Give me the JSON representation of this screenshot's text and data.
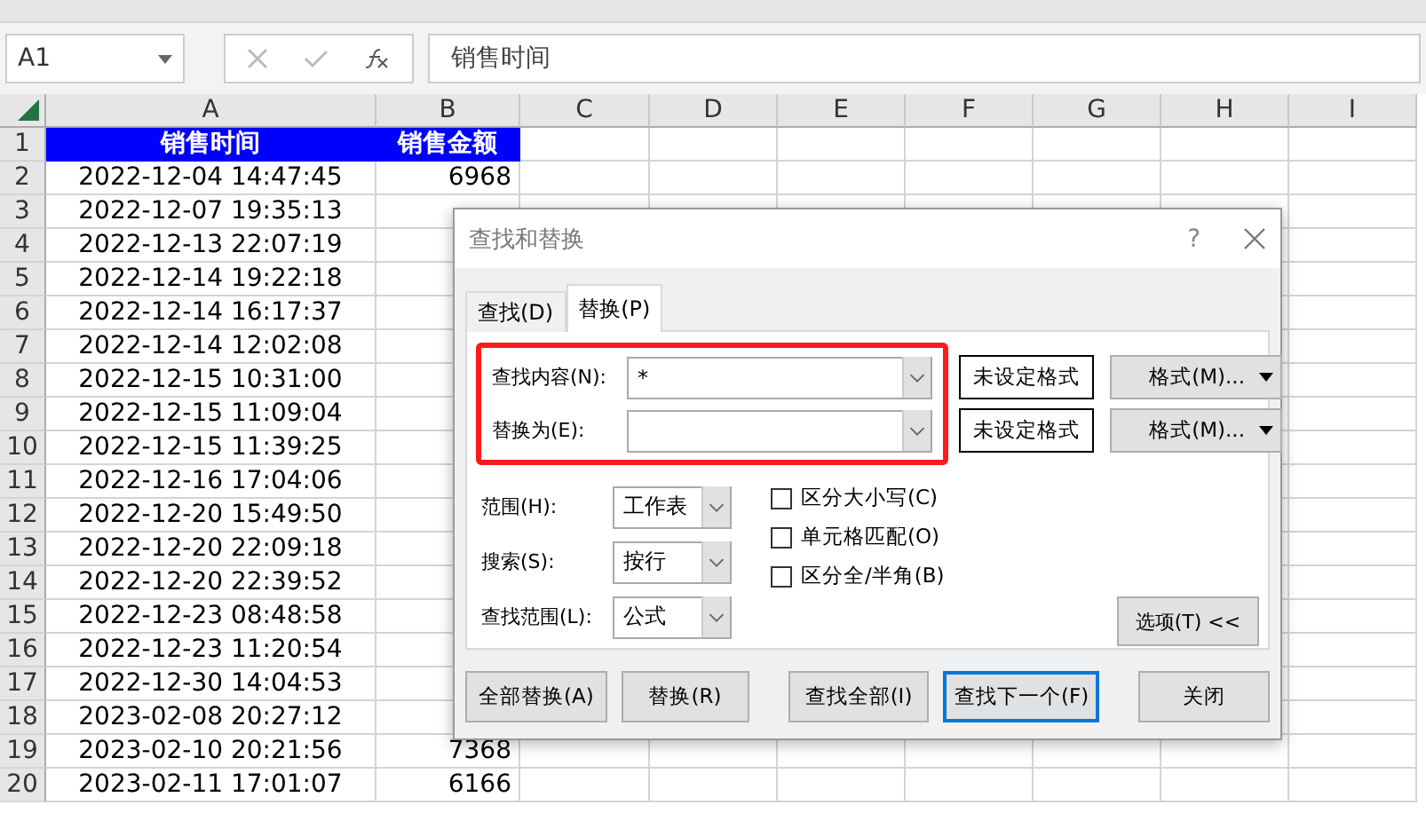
{
  "formula_bar": {
    "name_box": "A1",
    "formula": "销售时间"
  },
  "columns": [
    "A",
    "B",
    "C",
    "D",
    "E",
    "F",
    "G",
    "H",
    "I"
  ],
  "rows": [
    {
      "number": "1",
      "kind": "header",
      "cells": [
        "销售时间",
        "销售金额"
      ]
    },
    {
      "number": "2",
      "kind": "data",
      "cells": [
        "2022-12-04 14:47:45",
        "6968"
      ]
    },
    {
      "number": "3",
      "kind": "data",
      "cells": [
        "2022-12-07 19:35:13",
        ""
      ]
    },
    {
      "number": "4",
      "kind": "data",
      "cells": [
        "2022-12-13 22:07:19",
        ""
      ]
    },
    {
      "number": "5",
      "kind": "data",
      "cells": [
        "2022-12-14 19:22:18",
        ""
      ]
    },
    {
      "number": "6",
      "kind": "data",
      "cells": [
        "2022-12-14 16:17:37",
        ""
      ]
    },
    {
      "number": "7",
      "kind": "data",
      "cells": [
        "2022-12-14 12:02:08",
        ""
      ]
    },
    {
      "number": "8",
      "kind": "data",
      "cells": [
        "2022-12-15 10:31:00",
        ""
      ]
    },
    {
      "number": "9",
      "kind": "data",
      "cells": [
        "2022-12-15 11:09:04",
        ""
      ]
    },
    {
      "number": "10",
      "kind": "data",
      "cells": [
        "2022-12-15 11:39:25",
        ""
      ]
    },
    {
      "number": "11",
      "kind": "data",
      "cells": [
        "2022-12-16 17:04:06",
        ""
      ]
    },
    {
      "number": "12",
      "kind": "data",
      "cells": [
        "2022-12-20 15:49:50",
        ""
      ]
    },
    {
      "number": "13",
      "kind": "data",
      "cells": [
        "2022-12-20 22:09:18",
        ""
      ]
    },
    {
      "number": "14",
      "kind": "data",
      "cells": [
        "2022-12-20 22:39:52",
        ""
      ]
    },
    {
      "number": "15",
      "kind": "data",
      "cells": [
        "2022-12-23 08:48:58",
        ""
      ]
    },
    {
      "number": "16",
      "kind": "data",
      "cells": [
        "2022-12-23 11:20:54",
        ""
      ]
    },
    {
      "number": "17",
      "kind": "data",
      "cells": [
        "2022-12-30 14:04:53",
        ""
      ]
    },
    {
      "number": "18",
      "kind": "data",
      "cells": [
        "2023-02-08 20:27:12",
        ""
      ]
    },
    {
      "number": "19",
      "kind": "data",
      "cells": [
        "2023-02-10 20:21:56",
        "7368"
      ]
    },
    {
      "number": "20",
      "kind": "data",
      "cells": [
        "2023-02-11 17:01:07",
        "6166"
      ]
    }
  ],
  "dialog": {
    "title": "查找和替换",
    "help": "?",
    "tabs": [
      {
        "label": "查找(D)",
        "selected": false
      },
      {
        "label": "替换(P)",
        "selected": true
      }
    ],
    "fields": [
      {
        "label": "查找内容(N):",
        "value": "*",
        "format_preview": "未设定格式",
        "format_button": "格式(M)..."
      },
      {
        "label": "替换为(E):",
        "format_preview": "未设定格式",
        "format_button": "格式(M)..."
      }
    ],
    "selects": [
      {
        "label": "范围(H):",
        "value": "工作表"
      },
      {
        "label": "搜索(S):",
        "value": "按行"
      },
      {
        "label": "查找范围(L):",
        "value": "公式"
      }
    ],
    "checkboxes": [
      {
        "label": "区分大小写(C)",
        "checked": false
      },
      {
        "label": "单元格匹配(O)",
        "checked": false
      },
      {
        "label": "区分全/半角(B)",
        "checked": false
      }
    ],
    "options_button": "选项(T) <<",
    "buttons": [
      {
        "label": "全部替换(A)",
        "selected": false
      },
      {
        "label": "替换(R)",
        "selected": false
      },
      {
        "label": "查找全部(I)",
        "selected": false
      },
      {
        "label": "查找下一个(F)",
        "selected": true
      },
      {
        "label": "关闭",
        "selected": false
      }
    ]
  }
}
